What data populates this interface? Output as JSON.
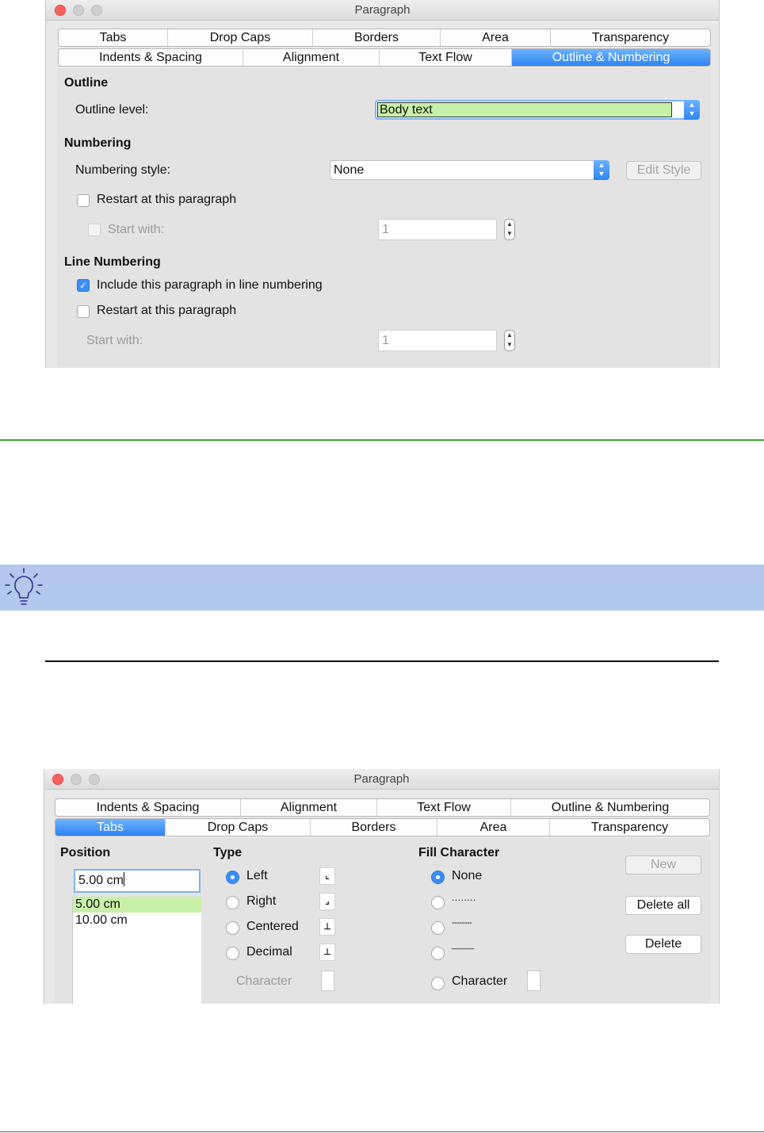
{
  "dialog1": {
    "title": "Paragraph",
    "tabs_row1": [
      "Tabs",
      "Drop Caps",
      "Borders",
      "Area",
      "Transparency"
    ],
    "tabs_row2": [
      "Indents & Spacing",
      "Alignment",
      "Text Flow",
      "Outline & Numbering"
    ],
    "active_tab": "Outline & Numbering",
    "outline": {
      "heading": "Outline",
      "level_label": "Outline level:",
      "level_value": "Body text"
    },
    "numbering": {
      "heading": "Numbering",
      "style_label": "Numbering style:",
      "style_value": "None",
      "edit_style_label": "Edit Style",
      "restart_label": "Restart at this paragraph",
      "restart_checked": false,
      "start_with_label": "Start with:",
      "start_with_value": "1"
    },
    "line_numbering": {
      "heading": "Line Numbering",
      "include_label": "Include this paragraph in line numbering",
      "include_checked": true,
      "restart_label": "Restart at this paragraph",
      "restart_checked": false,
      "start_with_label": "Start with:",
      "start_with_value": "1"
    }
  },
  "tip": {
    "icon": "lightbulb-icon",
    "color": "#b4c7ed"
  },
  "dialog2": {
    "title": "Paragraph",
    "tabs_row1": [
      "Indents & Spacing",
      "Alignment",
      "Text Flow",
      "Outline & Numbering"
    ],
    "tabs_row2": [
      "Tabs",
      "Drop Caps",
      "Borders",
      "Area",
      "Transparency"
    ],
    "active_tab": "Tabs",
    "position": {
      "heading": "Position",
      "input_value": "5.00 cm",
      "list": [
        "5.00 cm",
        "10.00 cm"
      ],
      "selected": "5.00 cm"
    },
    "type": {
      "heading": "Type",
      "options": [
        "Left",
        "Right",
        "Centered",
        "Decimal"
      ],
      "selected": "Left",
      "glyphs": [
        "⌞",
        "⌟",
        "⊥",
        "⊥"
      ],
      "character_label": "Character"
    },
    "fill": {
      "heading": "Fill Character",
      "options": [
        "None",
        "........",
        "--------",
        "______"
      ],
      "selected": "None",
      "character_label": "Character"
    },
    "buttons": {
      "new_label": "New",
      "delete_all_label": "Delete all",
      "delete_label": "Delete"
    }
  },
  "colors": {
    "accent": "#2f83f3",
    "highlight": "#c9f0a8",
    "separator_green": "#3aa535"
  }
}
